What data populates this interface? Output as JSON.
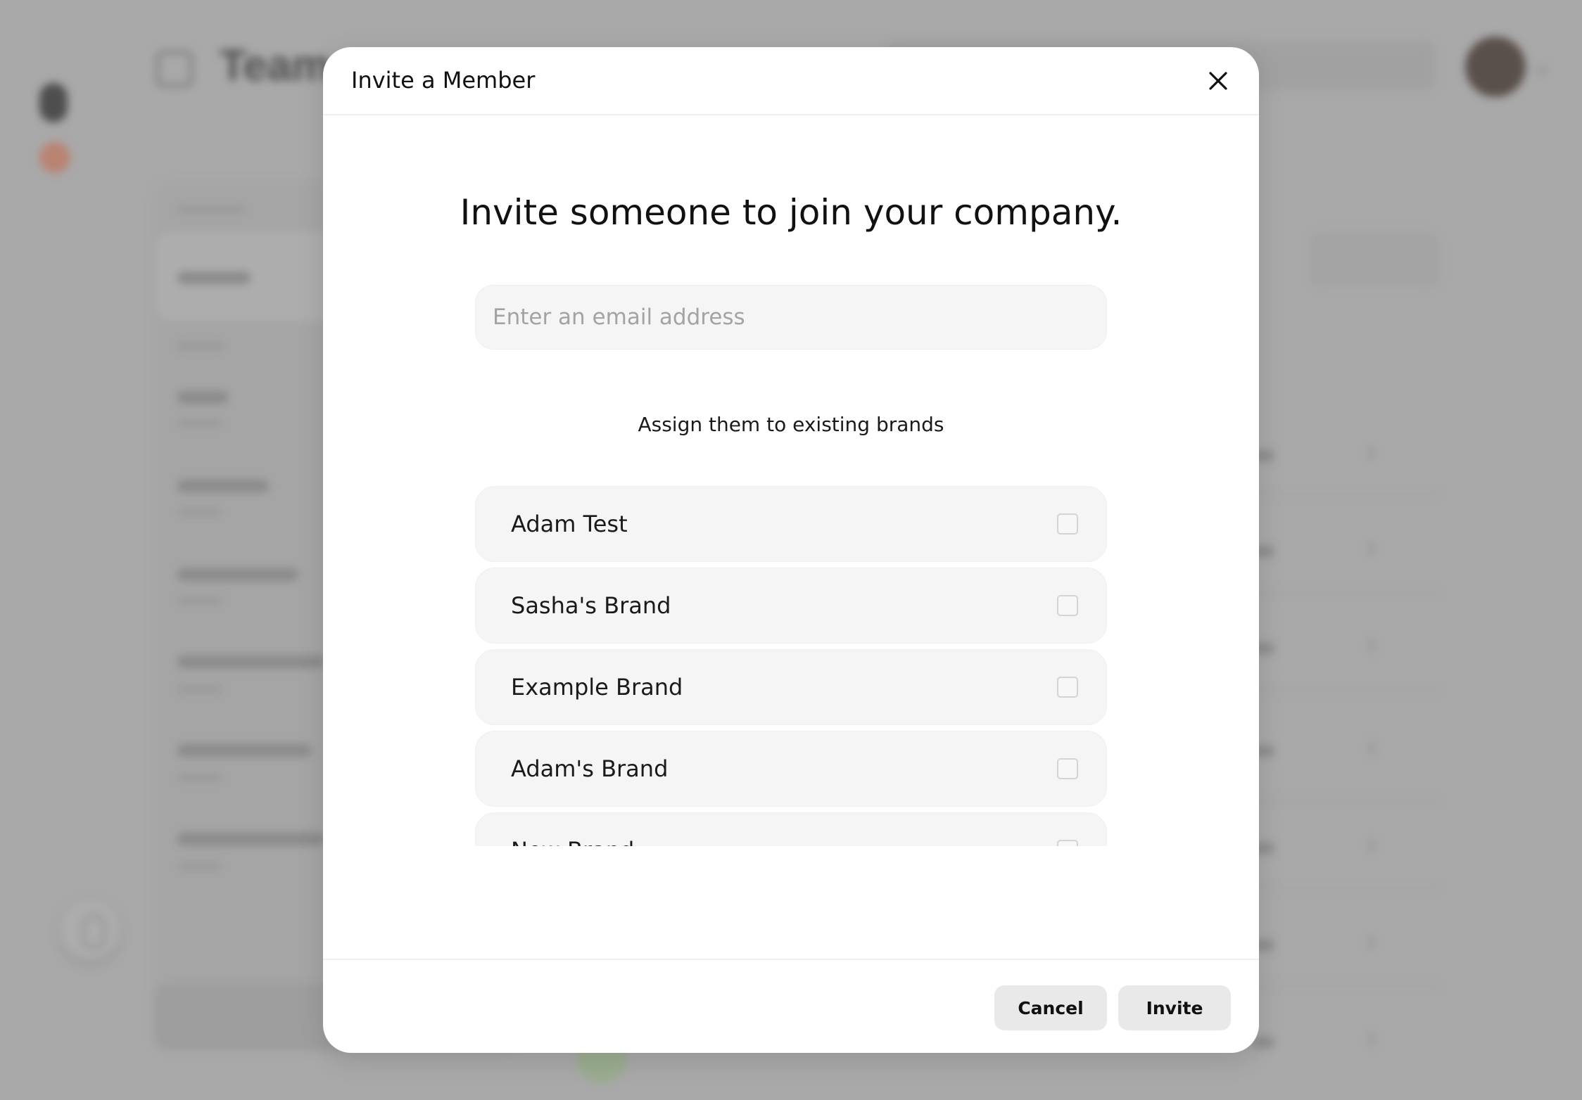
{
  "background": {
    "page_title": "Team"
  },
  "modal": {
    "title": "Invite a Member",
    "close_icon": "close-icon",
    "headline": "Invite someone to join your company.",
    "email_placeholder": "Enter an email address",
    "email_value": "",
    "assign_label": "Assign them to existing brands",
    "brands": [
      {
        "label": "Adam Test",
        "checked": false
      },
      {
        "label": "Sasha's Brand",
        "checked": false
      },
      {
        "label": "Example Brand",
        "checked": false
      },
      {
        "label": "Adam's Brand",
        "checked": false
      },
      {
        "label": "New Brand",
        "checked": false
      }
    ],
    "cancel_label": "Cancel",
    "invite_label": "Invite"
  }
}
